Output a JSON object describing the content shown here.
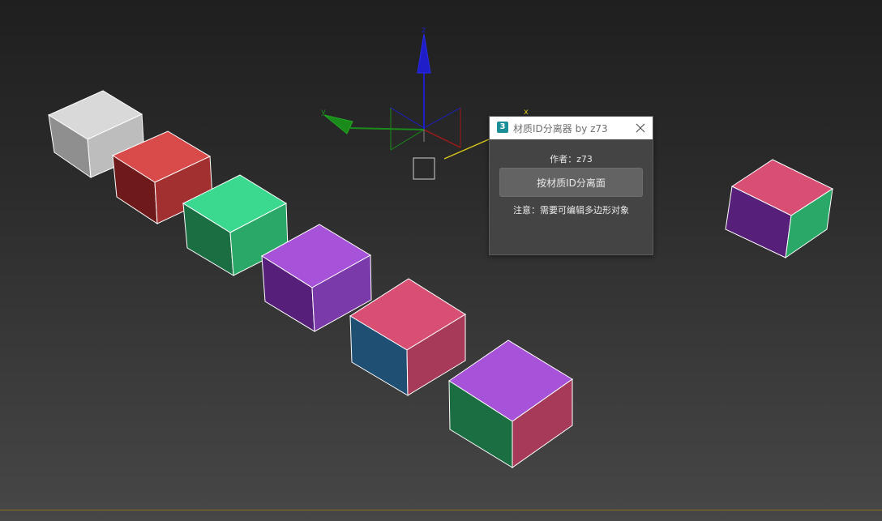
{
  "dialog": {
    "icon_label": "3",
    "title": "材质ID分离器 by z73",
    "author": "作者：z73",
    "button_label": "按材质ID分离面",
    "note": "注意：需要可编辑多边形对象"
  },
  "gizmo": {
    "z_label": "z",
    "y_label": "y",
    "x_label": "x",
    "colors": {
      "z_axis": "#1e1ec8",
      "y_axis": "#1a8a1a",
      "x_axis": "#d8c61a"
    }
  },
  "cubes": [
    {
      "name": "cube-white",
      "top": "#d9d9d9",
      "left": "#8f8f8f",
      "right": "#bdbdbd"
    },
    {
      "name": "cube-red",
      "top": "#d94a4a",
      "left": "#6e1a1a",
      "right": "#a33030"
    },
    {
      "name": "cube-green",
      "top": "#3bd990",
      "left": "#1a6e42",
      "right": "#2aa868"
    },
    {
      "name": "cube-purple",
      "top": "#a653d9",
      "left": "#56207a",
      "right": "#7a3aaa"
    },
    {
      "name": "cube-pink-blue",
      "top": "#d94f74",
      "left": "#1f4f73",
      "right": "#a63a58"
    },
    {
      "name": "cube-purple-green",
      "top": "#a653d9",
      "left": "#1a6e42",
      "right": "#a63a58"
    },
    {
      "name": "cube-isolated",
      "top": "#d94f74",
      "left": "#56207a",
      "right": "#2aa868"
    }
  ]
}
